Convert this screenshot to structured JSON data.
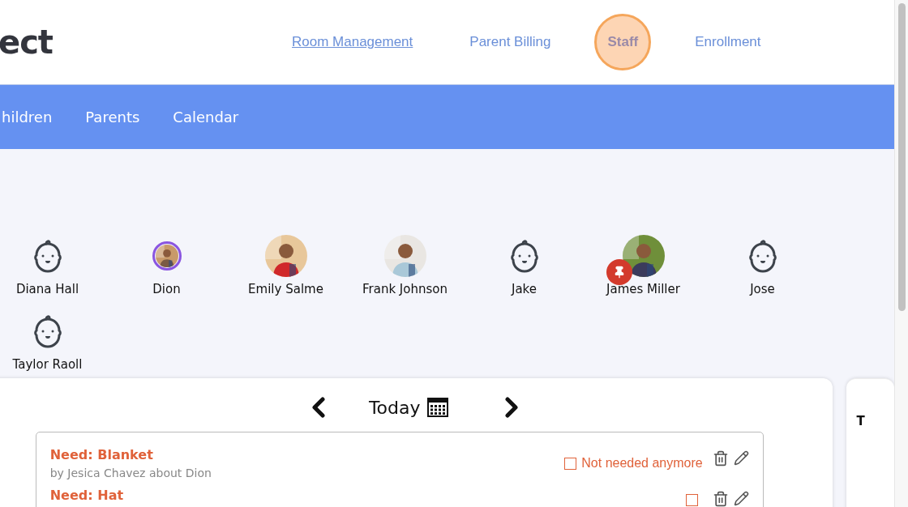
{
  "logo": {
    "text": "ect"
  },
  "top_nav": [
    {
      "label": "Room Management",
      "selected": true,
      "highlighted": false
    },
    {
      "label": "Parent Billing",
      "selected": false,
      "highlighted": false
    },
    {
      "label": "Staff",
      "selected": false,
      "highlighted": true
    },
    {
      "label": "Enrollment",
      "selected": false,
      "highlighted": false
    }
  ],
  "sub_nav": [
    {
      "label": "hildren"
    },
    {
      "label": "Parents"
    },
    {
      "label": "Calendar"
    }
  ],
  "children": [
    {
      "name": "Diana Hall",
      "kind": "icon",
      "ringed": false,
      "pinned": false
    },
    {
      "name": "Dion",
      "ringed": true,
      "pinned": false
    },
    {
      "name": "Emily Salme",
      "ringed": false,
      "pinned": false
    },
    {
      "name": "Frank Johnson",
      "ringed": false,
      "pinned": false
    },
    {
      "name": "Jake",
      "kind": "icon",
      "ringed": false,
      "pinned": false
    },
    {
      "name": "James Miller",
      "ringed": false,
      "pinned": true
    },
    {
      "name": "Jose",
      "kind": "icon",
      "ringed": false,
      "pinned": false
    },
    {
      "name": "Taylor Raoll",
      "kind": "icon",
      "ringed": false,
      "pinned": false
    }
  ],
  "day_nav": {
    "label": "Today"
  },
  "notes": [
    {
      "title": "Need: Blanket",
      "byline": "by Jesica Chavez about Dion",
      "checkbox_label": "Not needed anymore",
      "checked": false
    },
    {
      "title": "Need: Hat",
      "checked": false
    }
  ],
  "side_card": {
    "text": "T"
  }
}
